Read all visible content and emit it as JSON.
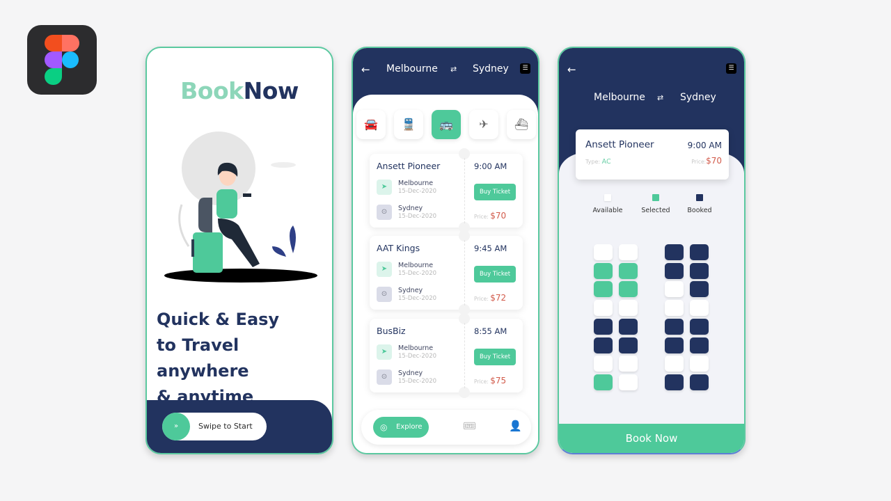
{
  "figma": {
    "icon": "figma-logo-icon"
  },
  "screen1": {
    "logo_part1": "Book",
    "logo_part2": "Now",
    "illustration": "traveler-illustration",
    "tagline": [
      "Quick & Easy",
      "to Travel anywhere",
      "& anytime"
    ],
    "swipe_label": "Swipe to Start",
    "swipe_icon": "»"
  },
  "screen2": {
    "back_icon": "←",
    "from": "Melbourne",
    "swap_icon": "⇄",
    "to": "Sydney",
    "filter_icon": "☰",
    "modes": [
      {
        "name": "car",
        "icon": "🚘",
        "active": false
      },
      {
        "name": "train",
        "icon": "🚆",
        "active": false
      },
      {
        "name": "bus",
        "icon": "🚌",
        "active": true
      },
      {
        "name": "plane",
        "icon": "✈",
        "active": false
      },
      {
        "name": "ship",
        "icon": "⛴",
        "active": false
      }
    ],
    "tickets": [
      {
        "operator": "Ansett Pioneer",
        "time": "9:00 AM",
        "from": "Melbourne",
        "from_date": "15-Dec-2020",
        "to": "Sydney",
        "to_date": "15-Dec-2020",
        "button": "Buy Ticket",
        "price_label": "Price:",
        "price": "$70"
      },
      {
        "operator": "AAT Kings",
        "time": "9:45 AM",
        "from": "Melbourne",
        "from_date": "15-Dec-2020",
        "to": "Sydney",
        "to_date": "15-Dec-2020",
        "button": "Buy Ticket",
        "price_label": "Price:",
        "price": "$72"
      },
      {
        "operator": "BusBiz",
        "time": "8:55 AM",
        "from": "Melbourne",
        "from_date": "15-Dec-2020",
        "to": "Sydney",
        "to_date": "15-Dec-2020",
        "button": "Buy Ticket",
        "price_label": "Price:",
        "price": "$75"
      }
    ],
    "nav": {
      "explore": "Explore",
      "explore_icon": "◎",
      "ticket_icon": "🎟",
      "profile_icon": "👤"
    }
  },
  "screen3": {
    "back_icon": "←",
    "filter_icon": "☰",
    "from": "Melbourne",
    "swap_icon": "⇄",
    "to": "Sydney",
    "summary": {
      "operator": "Ansett Pioneer",
      "time": "9:00 AM",
      "type_label": "Type:",
      "type": "AC",
      "price_label": "Price:",
      "price": "$70"
    },
    "legend": [
      {
        "label": "Available",
        "color": "#ffffff"
      },
      {
        "label": "Selected",
        "color": "#4ec99a"
      },
      {
        "label": "Booked",
        "color": "#22335f"
      }
    ],
    "seats": [
      [
        "available",
        "available",
        "booked",
        "booked"
      ],
      [
        "selected",
        "selected",
        "booked",
        "booked"
      ],
      [
        "selected",
        "selected",
        "available",
        "booked"
      ],
      [
        "available",
        "available",
        "available",
        "available"
      ],
      [
        "booked",
        "booked",
        "booked",
        "booked"
      ],
      [
        "booked",
        "booked",
        "booked",
        "booked"
      ],
      [
        "available",
        "available",
        "available",
        "available"
      ],
      [
        "selected",
        "available",
        "booked",
        "booked"
      ]
    ],
    "book_button": "Book Now"
  }
}
